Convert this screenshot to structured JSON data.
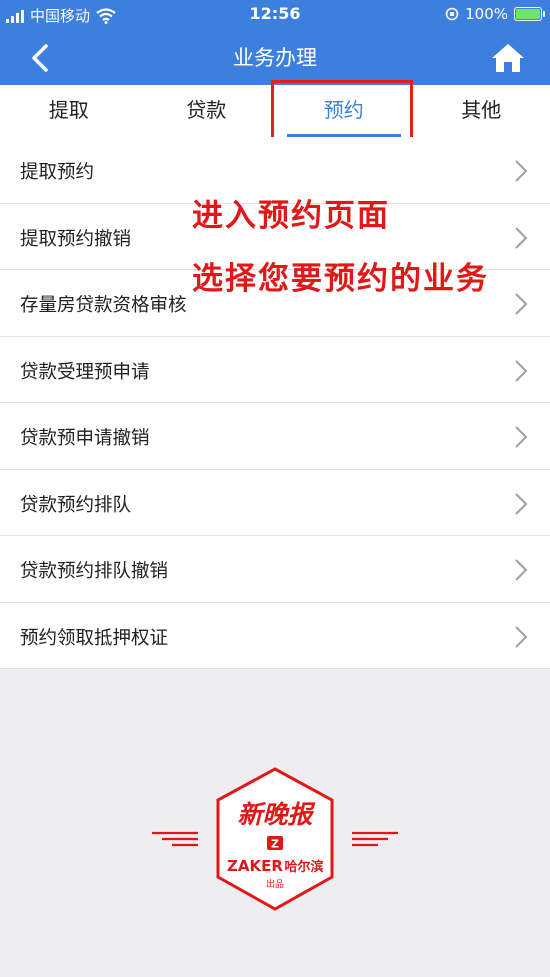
{
  "status_bar": {
    "carrier": "中国移动",
    "time": "12:56",
    "battery": "100%"
  },
  "nav": {
    "title": "业务办理"
  },
  "tabs": [
    {
      "label": "提取",
      "active": false
    },
    {
      "label": "贷款",
      "active": false
    },
    {
      "label": "预约",
      "active": true
    },
    {
      "label": "其他",
      "active": false
    }
  ],
  "list": [
    {
      "label": "提取预约"
    },
    {
      "label": "提取预约撤销"
    },
    {
      "label": "存量房贷款资格审核"
    },
    {
      "label": "贷款受理预申请"
    },
    {
      "label": "贷款预申请撤销"
    },
    {
      "label": "贷款预约排队"
    },
    {
      "label": "贷款预约排队撤销"
    },
    {
      "label": "预约领取抵押权证"
    }
  ],
  "annotation": {
    "line1": "进入预约页面",
    "line2": "选择您要预约的业务"
  },
  "watermark": {
    "brand": "新晚报",
    "z_letter": "Z",
    "zaker": "ZAKER",
    "city": "哈尔滨",
    "produced": "出品"
  },
  "colors": {
    "primary": "#3c7fdc",
    "annotation_red": "#e01818",
    "page_bg": "#eeeef0"
  }
}
